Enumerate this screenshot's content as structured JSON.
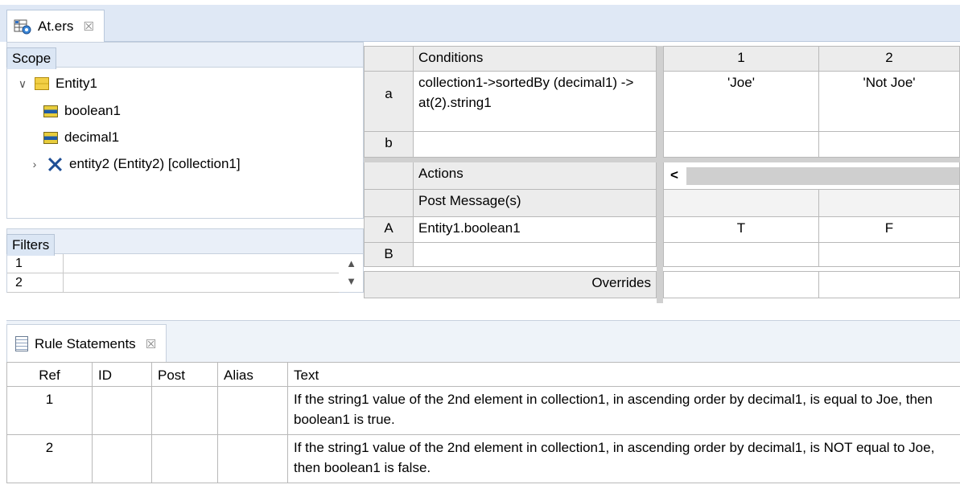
{
  "editor_tab": {
    "title": "At.ers",
    "close": "☒"
  },
  "scope": {
    "title": "Scope",
    "tree": [
      {
        "label": "Entity1",
        "chevron": "∨"
      },
      {
        "label": "boolean1"
      },
      {
        "label": "decimal1"
      },
      {
        "label": "entity2 (Entity2) [collection1]",
        "chevron": "›"
      }
    ]
  },
  "filters": {
    "title": "Filters",
    "rows": [
      "1",
      "2"
    ]
  },
  "decision_table": {
    "conditions_header": "Conditions",
    "actions_header": "Actions",
    "column_numbers": [
      "1",
      "2"
    ],
    "conditions": [
      {
        "letter": "a",
        "text": "collection1->sortedBy (decimal1) -> at(2).string1",
        "values": [
          "'Joe'",
          "'Not Joe'"
        ]
      },
      {
        "letter": "b",
        "text": "",
        "values": [
          "",
          ""
        ]
      }
    ],
    "post_message": "Post Message(s)",
    "actions": [
      {
        "letter": "A",
        "text": "Entity1.boolean1",
        "values": [
          "T",
          "F"
        ]
      },
      {
        "letter": "B",
        "text": "",
        "values": [
          "",
          ""
        ]
      }
    ],
    "overrides": "Overrides",
    "scroll_left": "<"
  },
  "rule_statements": {
    "title": "Rule Statements",
    "close": "☒",
    "columns": [
      "Ref",
      "ID",
      "Post",
      "Alias",
      "Text"
    ],
    "rows": [
      {
        "ref": "1",
        "id": "",
        "post": "",
        "alias": "",
        "text": "If the string1 value of the 2nd element in collection1, in ascending order by decimal1, is equal to Joe, then boolean1 is true."
      },
      {
        "ref": "2",
        "id": "",
        "post": "",
        "alias": "",
        "text": "If the string1 value of the 2nd element in collection1, in ascending order by decimal1, is NOT equal to Joe, then boolean1 is false."
      }
    ]
  }
}
